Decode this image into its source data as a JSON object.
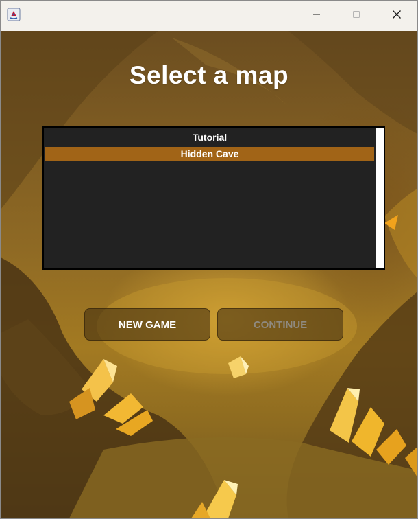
{
  "window": {
    "controls": {
      "minimize_icon": "minimize-icon",
      "maximize_icon": "maximize-icon",
      "close_icon": "close-icon"
    }
  },
  "title": "Select a map",
  "maps": {
    "items": [
      {
        "label": "Tutorial",
        "selected": false
      },
      {
        "label": "Hidden Cave",
        "selected": true
      }
    ],
    "selected_color": "#a16417",
    "background_color": "#222222"
  },
  "buttons": {
    "new_game": "NEW GAME",
    "continue": "CONTINUE",
    "continue_enabled": false
  }
}
